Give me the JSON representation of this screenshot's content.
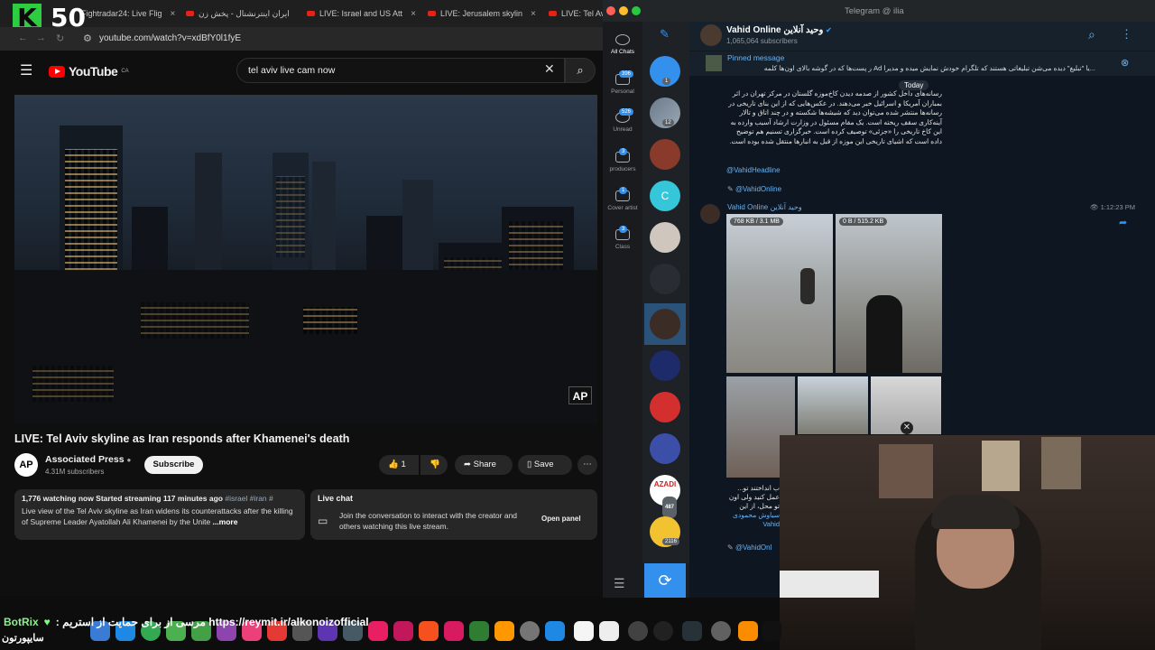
{
  "browser": {
    "tabs": [
      {
        "label": "Fightradar24: Live Flig"
      },
      {
        "label": "ایران اینترنشنال - پخش زن"
      },
      {
        "label": "LIVE: Israel and US Att"
      },
      {
        "label": "LIVE: Jerusalem skylin"
      },
      {
        "label": "LIVE: Tel Av"
      }
    ],
    "url": "youtube.com/watch?v=xdBfY0l1fyE"
  },
  "overlay": {
    "k_letter": "K",
    "k_count": "50"
  },
  "youtube": {
    "logo": "YouTube",
    "region": "CA",
    "search_value": "tel aviv live cam now",
    "video_badge": "AP",
    "video_title": "LIVE: Tel Aviv skyline as Iran responds after Khamenei's death",
    "channel": {
      "avatar_text": "AP",
      "name": "Associated Press",
      "subscribers": "4.31M subscribers"
    },
    "subscribe_label": "Subscribe",
    "likes": "1",
    "share_label": "Share",
    "save_label": "Save",
    "description": {
      "meta": "1,776 watching now  Started streaming 117 minutes ago",
      "tags": "#israel #iran #",
      "text": "Live view of the Tel Aviv skyline as Iran widens its counterattacks after the killing of Supreme Leader Ayatollah Ali Khamenei by the Unite",
      "more": "...more"
    },
    "live_chat": {
      "title": "Live chat",
      "text": "Join the conversation to interact with the creator and others watching this live stream.",
      "open_panel": "Open panel"
    }
  },
  "telegram": {
    "window_title": "Telegram @ ilia",
    "folders": [
      {
        "label": "All Chats",
        "badge": ""
      },
      {
        "label": "Personal",
        "badge": "396"
      },
      {
        "label": "Unread",
        "badge": "526"
      },
      {
        "label": "producers",
        "badge": "3"
      },
      {
        "label": "Cover artist",
        "badge": "1"
      },
      {
        "label": "Class",
        "badge": "3"
      }
    ],
    "chat_counts": {
      "c1": "1",
      "c2": "12",
      "c3": "487",
      "c4": "2116"
    },
    "chat_letter": "C",
    "chat_logo_text": "AZADI",
    "channel_name": "Vahid Online وحید آنلاین",
    "channel_subs": "1,065,064 subscribers",
    "pinned_label": "Pinned message",
    "pinned_text": "ر پست‌ها که در گوشه بالای اون‌ها کلمه Ad یا \"تبلیغ\" دیده می‌شن تبلیغاتی هستند که تلگرام خودش نمایش میده و مدیرا...",
    "today": "Today",
    "message1": "رسانه‌های داخل کشور از صدمه دیدن کاخ‌موزه گلستان در مرکز تهران در اثر بمباران آمریکا و اسرائیل خبر می‌دهند. در عکس‌هایی که از این بنای تاریخی در رسانه‌ها منتشر شده می‌توان دید که شیشه‌ها شکسته و در چند اتاق و تالار آینه‌کاری سقف ریخته است. یک مقام مسئول در وزارت ارشاد آسیب وارده به این کاخ تاریخی را «جزئی» توصیف کرده است. خبرگزاری تسنیم هم توضیح داده است که اشیای تاریخی این موزه از قبل به انبارها منتقل شده بوده است.",
    "mention_headline": "@VahidHeadline",
    "mention_online": "@VahidOnline",
    "sender": "Vahid Online وحید آنلاین",
    "time": "1:12:23 PM",
    "photo_sizes": [
      "768 KB / 3.1 MB",
      "0 B / 515.2 KB"
    ],
    "message2_lines": [
      "...ب انداختند تو",
      "عمل کنید ولی اون",
      "تو محل، از این",
      "سیاوش محمودی",
      "Vahid"
    ],
    "mention_online2": "@VahidOnl"
  },
  "stream": {
    "ticker_bot": "BotRix",
    "ticker_text": ": مرسی از  برای حمایت از استریم https://reymit.ir/alkonoizofficial",
    "bottom_name": "سایپورتون"
  }
}
